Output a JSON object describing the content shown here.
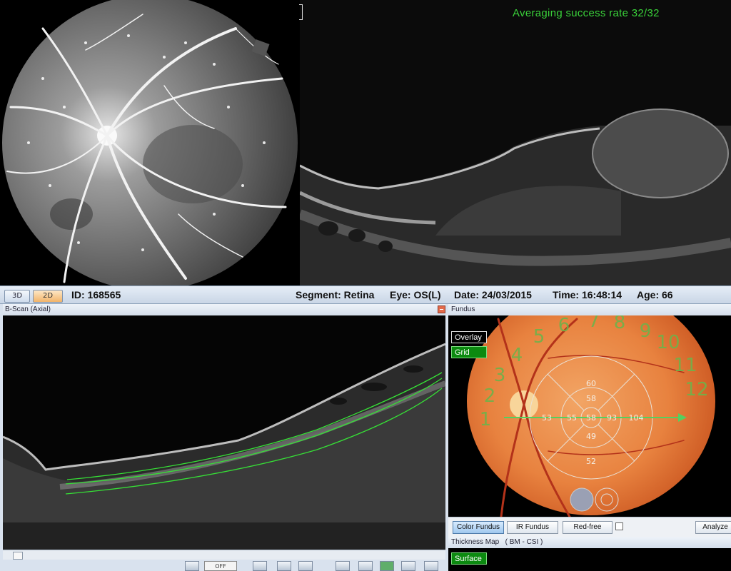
{
  "top": {
    "averaging_label": "Averaging success rate  32/32"
  },
  "header": {
    "tab_3d": "3D",
    "tab_2d": "2D",
    "id": "ID: 168565",
    "segment": "Segment: Retina",
    "eye": "Eye: OS(L)",
    "date": "Date: 24/03/2015",
    "time": "Time: 16:48:14",
    "age": "Age: 66"
  },
  "bscan": {
    "title": "B-Scan (Axial)",
    "off_label": "OFF"
  },
  "fundus": {
    "title": "Fundus",
    "overlay_button": "Overlay",
    "grid_button": "Grid",
    "grid_values": {
      "outer_superior": "60",
      "inner_superior": "58",
      "center": "58",
      "inner_nasal": "93",
      "outer_nasal": "104",
      "inner_temporal": "55",
      "outer_temporal": "53",
      "inner_inferior": "49",
      "outer_inferior": "52"
    },
    "clock_numbers": [
      "1",
      "2",
      "3",
      "4",
      "5",
      "6",
      "7",
      "8",
      "9",
      "10",
      "11",
      "12"
    ],
    "buttons": {
      "color_fundus": "Color Fundus",
      "ir_fundus": "IR Fundus",
      "red_free": "Red-free",
      "analyze": "Analyze"
    }
  },
  "thickness": {
    "title": "Thickness Map   ( BM - CSI )",
    "surface_button": "Surface"
  },
  "colors": {
    "accent_green": "#3ad13a",
    "active_tab": "#f2b46a",
    "segmentation_line": "#36e036"
  }
}
